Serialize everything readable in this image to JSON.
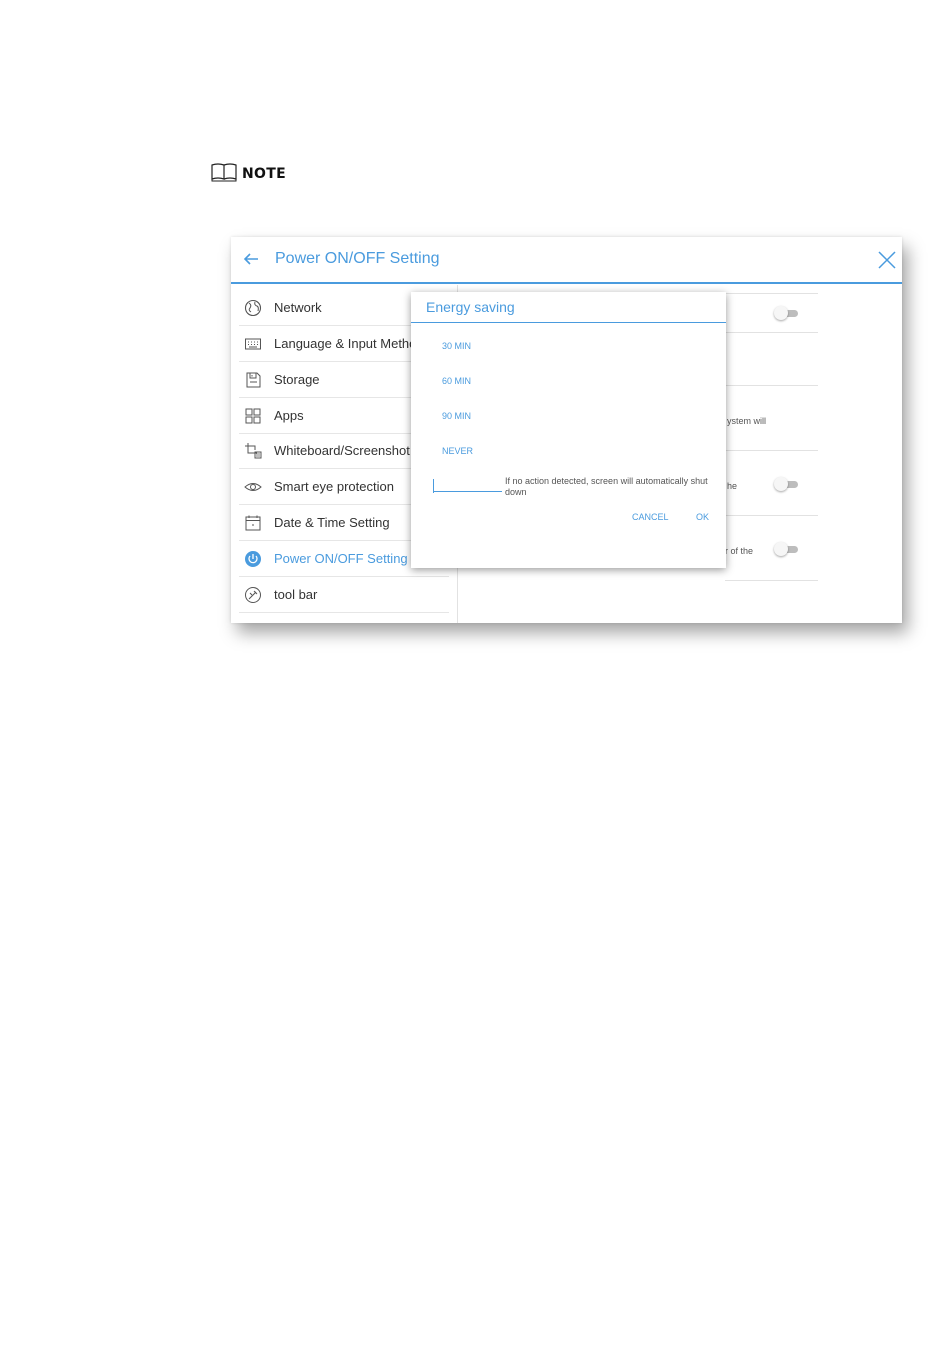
{
  "note": {
    "label": "NOTE"
  },
  "header": {
    "title": "Power ON/OFF Setting"
  },
  "sidebar": {
    "items": [
      {
        "label": "Network",
        "icon": "globe-icon"
      },
      {
        "label": "Language & Input Metho",
        "icon": "keyboard-icon"
      },
      {
        "label": "Storage",
        "icon": "storage-icon"
      },
      {
        "label": "Apps",
        "icon": "apps-grid-icon"
      },
      {
        "label": "Whiteboard/Screenshot",
        "icon": "crop-icon"
      },
      {
        "label": "Smart eye protection",
        "icon": "eye-icon"
      },
      {
        "label": "Date & Time Setting",
        "icon": "calendar-icon"
      },
      {
        "label": "Power ON/OFF Setting",
        "icon": "power-icon",
        "active": true
      },
      {
        "label": "tool bar",
        "icon": "toolbar-icon"
      }
    ]
  },
  "background_panel": {
    "text_system_will": "ystem will",
    "text_he": "he",
    "text_of_the": "r of the"
  },
  "dialog": {
    "title": "Energy saving",
    "options": [
      "30 MIN",
      "60 MIN",
      "90 MIN",
      "NEVER"
    ],
    "hint": "If no action detected, screen will automatically shut down",
    "cancel_label": "CANCEL",
    "ok_label": "OK"
  },
  "colors": {
    "accent": "#4a9bde",
    "text": "#333333",
    "divider": "#e2e2e2"
  }
}
